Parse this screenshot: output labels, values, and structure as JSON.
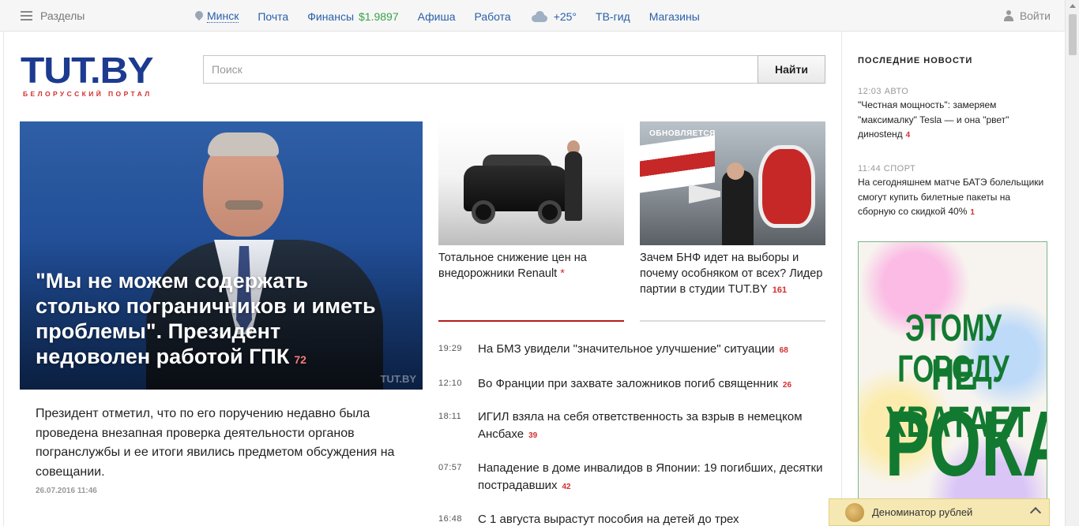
{
  "topbar": {
    "sections_label": "Разделы",
    "city": "Минск",
    "mail": "Почта",
    "finance": "Финансы",
    "finance_rate": "$1.9897",
    "afisha": "Афиша",
    "jobs": "Работа",
    "weather_temp": "+25°",
    "tv": "ТВ-гид",
    "shops": "Магазины",
    "login": "Войти"
  },
  "logo": {
    "mark_main": "TUT",
    "mark_dot": ".BY",
    "tagline": "БЕЛОРУССКИЙ ПОРТАЛ"
  },
  "search": {
    "placeholder": "Поиск",
    "button_label": "Найти"
  },
  "main_story": {
    "headline": "\"Мы не можем содержать столько пограничников и иметь проблемы\". Президент недоволен работой ГПК",
    "comments": "72",
    "watermark": "TUT.BY",
    "lead": "Президент отметил, что по его поручению недавно была проведена внезапная проверка деятельности органов погранслужбы и ее итоги явились предметом обсуждения на совещании.",
    "date": "26.07.2016 11:46"
  },
  "cards": [
    {
      "title": "Тотальное снижение цен на внедорожники Renault",
      "marker": "*",
      "image": "dark-suv-with-man"
    },
    {
      "badge": "ОБНОВЛЯЕТСЯ",
      "title": "Зачем БНФ идет на выборы и почему особняком от всех? Лидер партии в студии TUT.BY",
      "comments": "161",
      "image": "rally-with-megaphone"
    }
  ],
  "feed": [
    {
      "time": "19:29",
      "text": "На БМЗ увидели \"значительное улучшение\" ситуации",
      "comments": "68"
    },
    {
      "time": "12:10",
      "text": "Во Франции при захвате заложников погиб священник",
      "comments": "26"
    },
    {
      "time": "18:11",
      "text": "ИГИЛ взяла на себя ответственность за взрыв в немецком Ансбахе",
      "comments": "39"
    },
    {
      "time": "07:57",
      "text": "Нападение в доме инвалидов в Японии: 19 погибших, десятки пострадавших",
      "comments": "42"
    },
    {
      "time": "16:48",
      "text": "С 1 августа вырастут пособия на детей до трех",
      "comments": ""
    }
  ],
  "sidebar": {
    "title": "ПОСЛЕДНИЕ НОВОСТИ",
    "items": [
      {
        "time": "12:03",
        "rubric": "АВТО",
        "text": "\"Честная мощность\": замеряем \"максималку\" Tesla — и она \"рвет\" динostенд",
        "comments": "4"
      },
      {
        "time": "11:44",
        "rubric": "СПОРТ",
        "text": "На сегодняшнем матче БАТЭ болельщики смогут купить билетные пакеты на сборную со скидкой 40%",
        "comments": "1"
      }
    ]
  },
  "ad": {
    "line1": "ЭТОМУ ГОРОДУ",
    "line2": "НЕ ХВАТАЕТ",
    "line3": "РОКА"
  },
  "toast": {
    "label": "Деноминатор рублей"
  },
  "colors": {
    "link": "#2a5fa8",
    "accent_red": "#d32f2f",
    "brand_blue": "#1c3a8f",
    "rate_green": "#3aa14a",
    "ad_green": "#127a30"
  }
}
